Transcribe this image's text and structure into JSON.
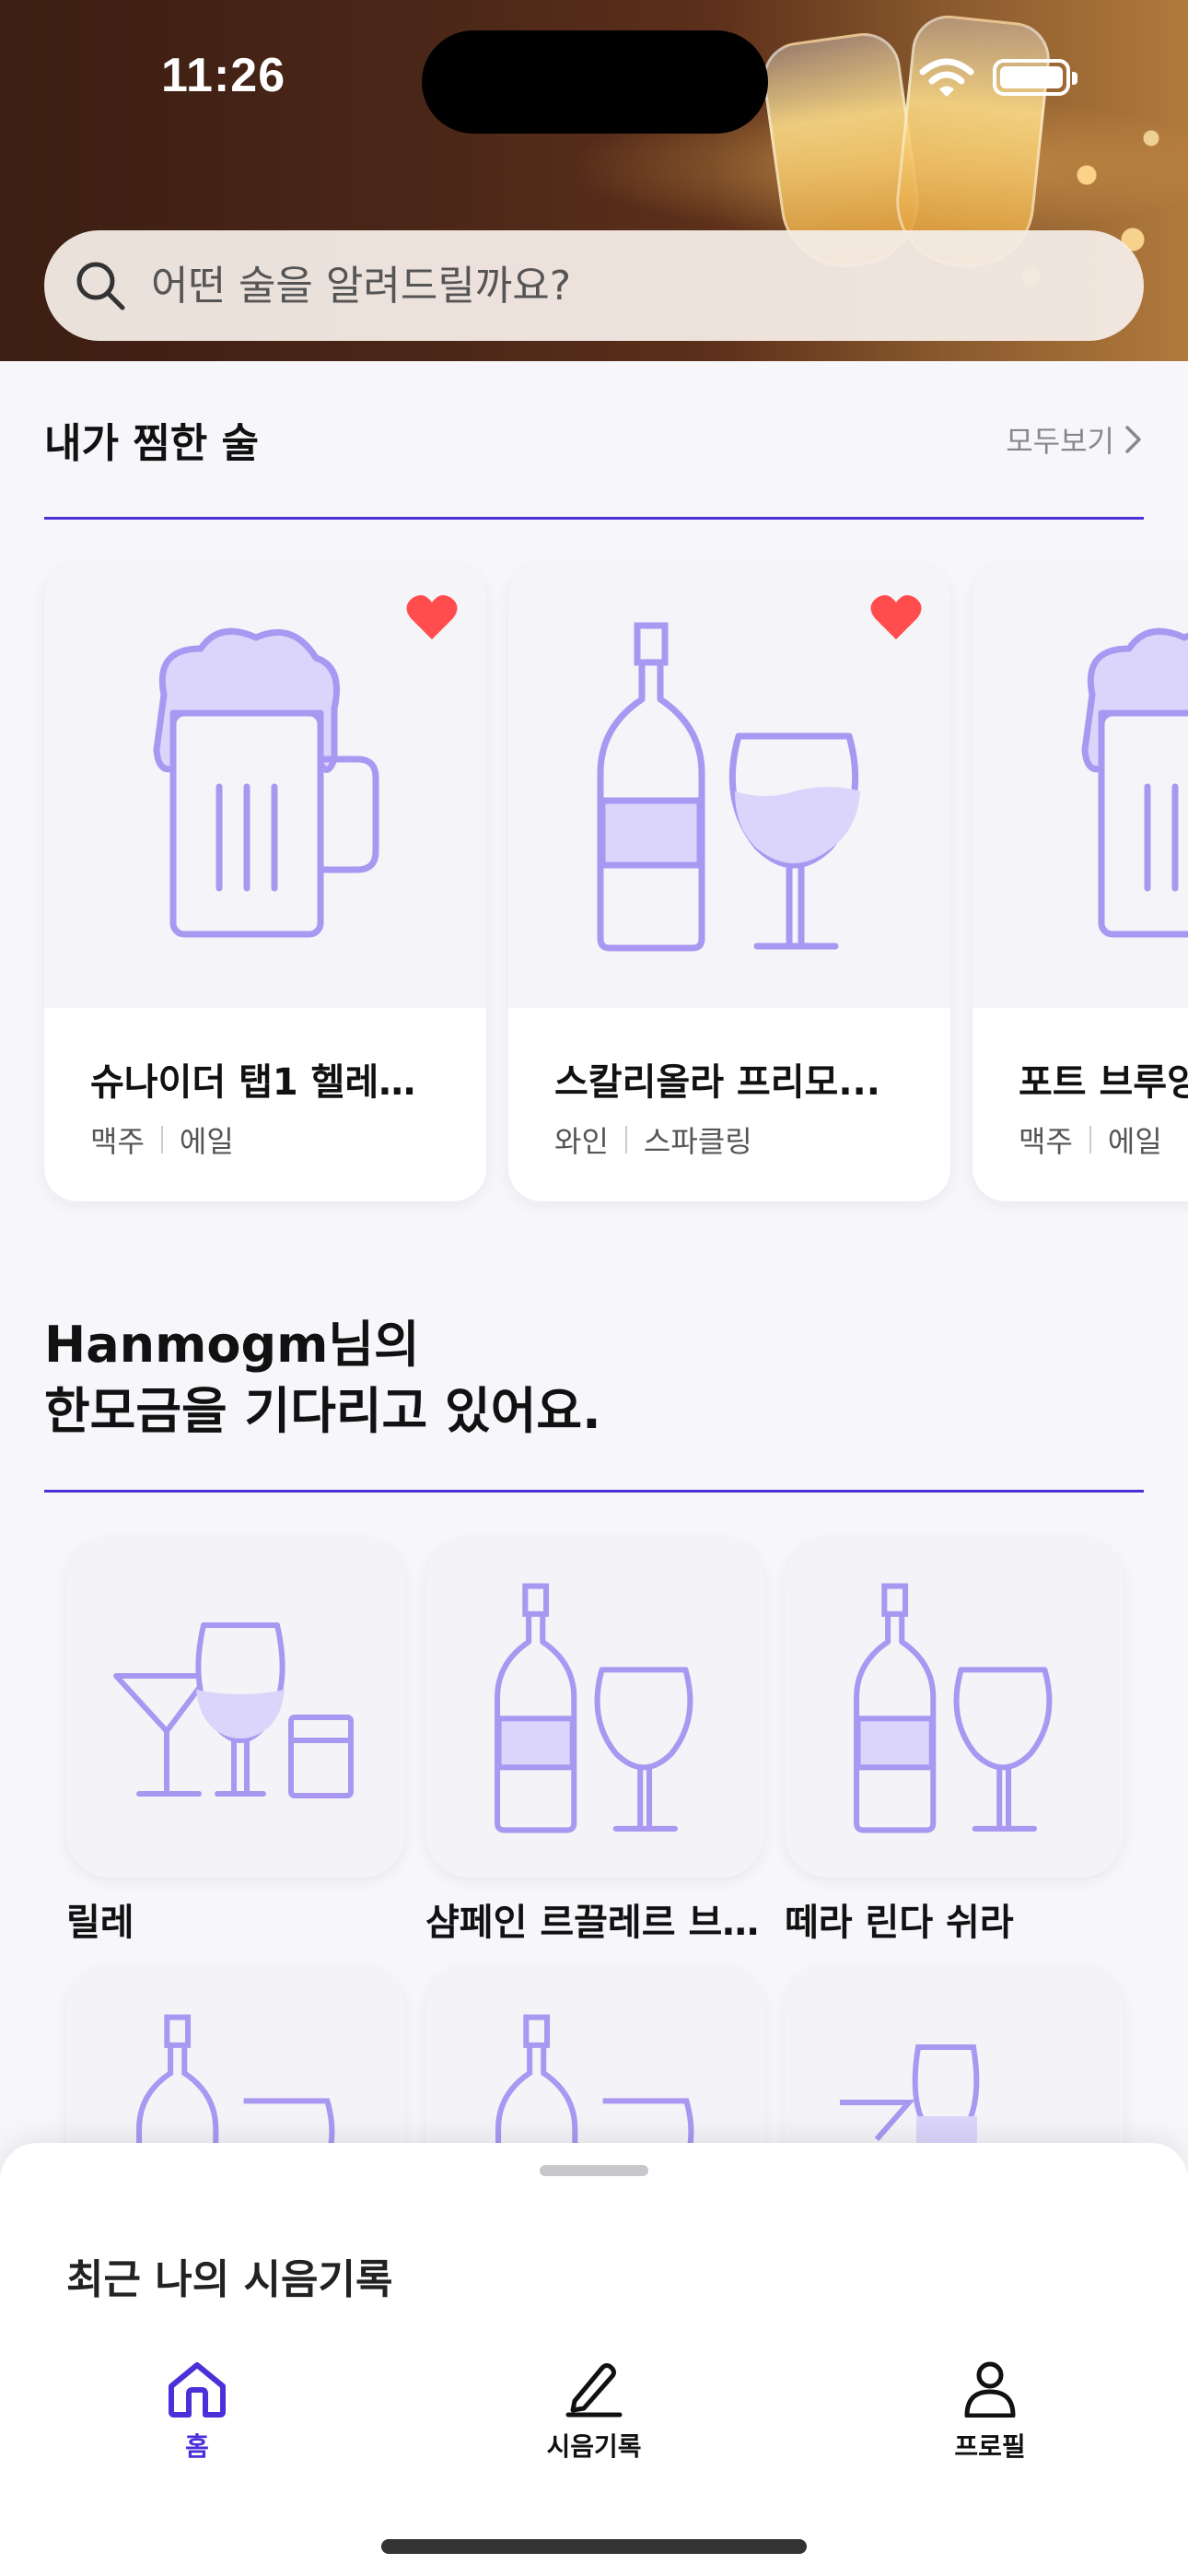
{
  "status_bar": {
    "time": "11:26"
  },
  "search": {
    "placeholder": "어떤 술을 알려드릴까요?"
  },
  "favorites": {
    "title": "내가 찜한 술",
    "see_all": "모두보기",
    "items": [
      {
        "name": "슈나이더 탭1 헬레…",
        "category": "맥주",
        "style": "에일",
        "icon": "beer-mug-icon",
        "favorited": true
      },
      {
        "name": "스칼리올라 프리모...",
        "category": "와인",
        "style": "스파클링",
        "icon": "wine-bottle-glass-icon",
        "favorited": true
      },
      {
        "name": "포트 브루잉",
        "category": "맥주",
        "style": "에일",
        "icon": "beer-mug-icon",
        "favorited": true
      }
    ]
  },
  "waiting": {
    "title_line1": "Hanmogm님의",
    "title_line2": "한모금을 기다리고 있어요.",
    "items": [
      {
        "name": "릴레",
        "icon": "cocktail-glasses-icon"
      },
      {
        "name": "샴페인 르끌레르 브…",
        "icon": "wine-bottle-glass-icon"
      },
      {
        "name": "떼라 린다 쉬라",
        "icon": "wine-bottle-glass-icon"
      },
      {
        "name": "",
        "icon": "wine-bottle-glass-icon"
      },
      {
        "name": "",
        "icon": "wine-bottle-glass-icon"
      },
      {
        "name": "",
        "icon": "cocktail-glasses-icon"
      }
    ]
  },
  "sheet": {
    "title": "최근 나의 시음기록"
  },
  "tabs": [
    {
      "label": "홈",
      "icon": "home-icon",
      "active": true
    },
    {
      "label": "시음기록",
      "icon": "pencil-icon",
      "active": false
    },
    {
      "label": "프로필",
      "icon": "person-icon",
      "active": false
    }
  ],
  "colors": {
    "accent": "#4b2fd8",
    "icon_stroke": "#a998f2",
    "icon_fill": "#dcd5fb",
    "heart": "#ff4d4d"
  }
}
